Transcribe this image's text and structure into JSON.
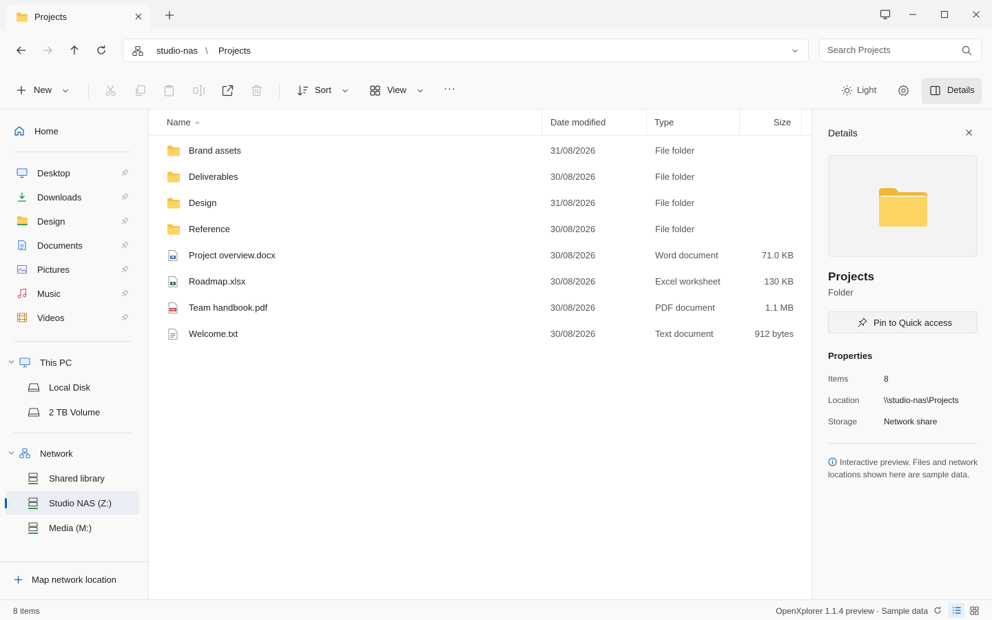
{
  "tab": {
    "title": "Projects"
  },
  "address": {
    "crumbs": [
      "studio-nas",
      "Projects"
    ],
    "separator": "\\"
  },
  "search": {
    "placeholder": "Search Projects"
  },
  "toolbar": {
    "new_label": "New",
    "sort_label": "Sort",
    "view_label": "View",
    "more_label": "···",
    "theme_label": "Light",
    "details_label": "Details"
  },
  "sidebar": {
    "home": "Home",
    "quick": [
      "Desktop",
      "Downloads",
      "Design",
      "Documents",
      "Pictures",
      "Music",
      "Videos"
    ],
    "this_pc": "This PC",
    "drives": [
      "Local Disk",
      "2 TB Volume"
    ],
    "network": "Network",
    "shares": [
      "Shared library",
      "Studio NAS (Z:)",
      "Media (M:)"
    ],
    "map_network": "Map network location"
  },
  "columns": {
    "name": "Name",
    "date": "Date modified",
    "type": "Type",
    "size": "Size"
  },
  "files": [
    {
      "name": "Brand assets",
      "date": "31/08/2026",
      "type": "File folder",
      "size": "",
      "icon": "folder-icon"
    },
    {
      "name": "Deliverables",
      "date": "30/08/2026",
      "type": "File folder",
      "size": "",
      "icon": "folder-icon"
    },
    {
      "name": "Design",
      "date": "31/08/2026",
      "type": "File folder",
      "size": "",
      "icon": "folder-icon"
    },
    {
      "name": "Reference",
      "date": "30/08/2026",
      "type": "File folder",
      "size": "",
      "icon": "folder-icon"
    },
    {
      "name": "Project overview.docx",
      "date": "30/08/2026",
      "type": "Word document",
      "size": "71.0 KB",
      "icon": "word-file-icon"
    },
    {
      "name": "Roadmap.xlsx",
      "date": "30/08/2026",
      "type": "Excel worksheet",
      "size": "130 KB",
      "icon": "excel-file-icon"
    },
    {
      "name": "Team handbook.pdf",
      "date": "30/08/2026",
      "type": "PDF document",
      "size": "1.1 MB",
      "icon": "pdf-file-icon"
    },
    {
      "name": "Welcome.txt",
      "date": "30/08/2026",
      "type": "Text document",
      "size": "912 bytes",
      "icon": "text-file-icon"
    }
  ],
  "details": {
    "title": "Details",
    "name": "Projects",
    "kind": "Folder",
    "pin_label": "Pin to Quick access",
    "properties_heading": "Properties",
    "properties": [
      {
        "key": "Items",
        "value": "8"
      },
      {
        "key": "Location",
        "value": "\\\\studio-nas\\Projects"
      },
      {
        "key": "Storage",
        "value": "Network share"
      }
    ],
    "note": "Interactive preview. Files and network locations shown here are sample data."
  },
  "status": {
    "count": "8 items",
    "version": "OpenXplorer 1.1.4 preview · Sample data"
  },
  "colors": {
    "accent": "#005fb8",
    "folder": "#f7c24a",
    "network_green": "#2ea043",
    "word": "#2b579a",
    "excel": "#217346",
    "pdf": "#d13438"
  }
}
